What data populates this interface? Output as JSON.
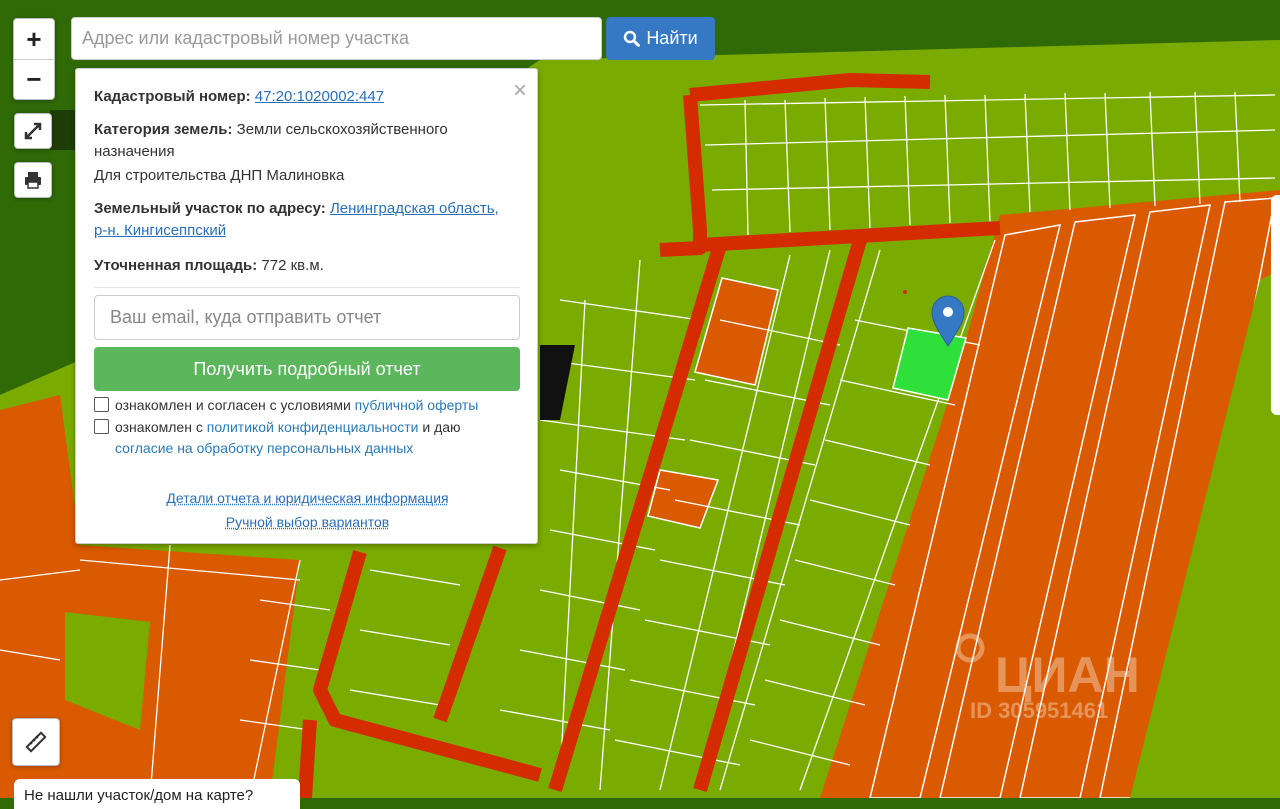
{
  "search": {
    "placeholder": "Адрес или кадастровый номер участка",
    "button_label": "Найти",
    "button_icon": "search-icon"
  },
  "zoom": {
    "in_label": "+",
    "out_label": "−"
  },
  "toolbar": {
    "fullscreen_icon": "fullscreen-icon",
    "print_icon": "print-icon",
    "ruler_icon": "ruler-icon"
  },
  "panel": {
    "close_label": "×",
    "cadastral_label": "Кадастровый номер:",
    "cadastral_value": "47:20:1020002:447",
    "category_label": "Категория земель:",
    "category_value": "Земли сельскохозяйственного назначения",
    "usage": "Для строительства ДНП Малиновка",
    "address_label": "Земельный участок по адресу:",
    "address_value": "Ленинградская область, р-н. Кингисеппский",
    "area_label": "Уточненная площадь:",
    "area_value": "772 кв.м.",
    "email_placeholder": "Ваш email, куда отправить отчет",
    "report_button": "Получить подробный отчет",
    "consent1_prefix": "ознакомлен и согласен с условиями",
    "consent1_link": "публичной оферты",
    "consent2_prefix": "ознакомлен с",
    "consent2_link": "политикой конфиденциальности",
    "consent2_mid": "и даю",
    "consent2_link2": "согласие на обработку персональных данных",
    "details_link": "Детали отчета и юридическая информация",
    "manual_link": "Ручной выбор вариантов"
  },
  "watermark": {
    "brand": "ЦИАН",
    "id": "ID 305951461"
  },
  "bottom_tip": "Не нашли участок/дом на карте?",
  "colors": {
    "field": "#7aab00",
    "orange": "#d95a00",
    "road": "#d52b00",
    "forest": "#2f6a07",
    "selected": "#2fe03a",
    "accent": "#3578c3",
    "report": "#5cb65c"
  }
}
